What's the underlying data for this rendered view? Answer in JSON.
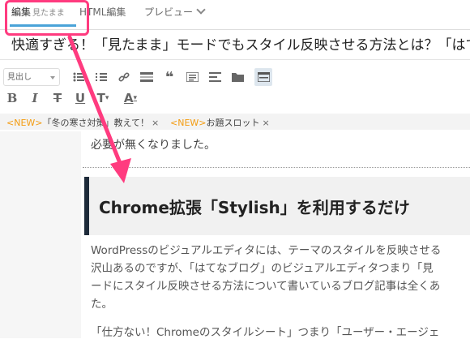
{
  "tabs": {
    "edit_label": "編集",
    "edit_mode": "見たまま",
    "html_label": "HTML編集",
    "preview_label": "プレビュー"
  },
  "title": {
    "value": "快適すぎる！「見たまま」モードでもスタイル反映させる方法とは？「はて"
  },
  "toolbar": {
    "format_select": "見出し"
  },
  "tags": [
    {
      "new": "<NEW>",
      "text": "「冬の寒さ対策」教えて！"
    },
    {
      "new": "<NEW>",
      "text": "お題スロット"
    }
  ],
  "content": {
    "line1": "必要が無くなりました。",
    "heading": "Chrome拡張「Stylish」を利用するだけ",
    "para_lines": [
      "WordPressのビジュアルエディタには、テーマのスタイルを反映させる",
      "沢山あるのですが、「はてなブログ」のビジュアルエディタつまり「見",
      "ードにスタイル反映させる方法について書いているブログ記事は全くあ",
      "た。"
    ],
    "para2": "「仕方ない！Chromeのスタイルシート」つまり「ユーザー・エージェ"
  },
  "colors": {
    "highlight": "#ff3b7f",
    "tab_active": "#4aa3d8",
    "heading_bar": "#1e2b3a",
    "new_tag": "#f39c12"
  }
}
